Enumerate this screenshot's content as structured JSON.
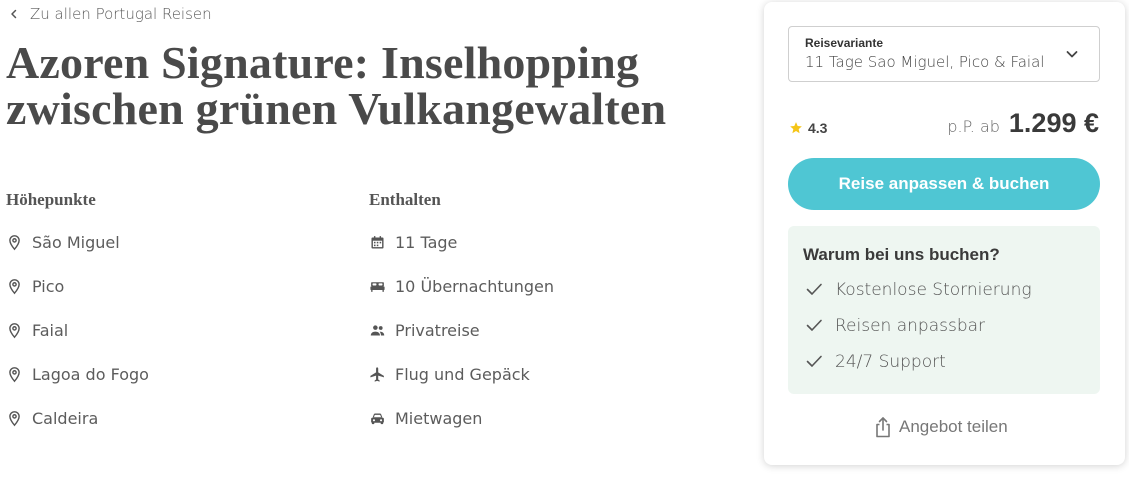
{
  "nav": {
    "back_label": "Zu allen Portugal Reisen"
  },
  "title": {
    "line1": "Azoren Signature: Inselhopping",
    "line2": "zwischen grünen Vulkangewalten"
  },
  "highlights": {
    "heading": "Höhepunkte",
    "items": [
      {
        "label": "São Miguel",
        "icon": "location-pin-icon"
      },
      {
        "label": "Pico",
        "icon": "location-pin-icon"
      },
      {
        "label": "Faial",
        "icon": "location-pin-icon"
      },
      {
        "label": "Lagoa do Fogo",
        "icon": "location-pin-icon"
      },
      {
        "label": "Caldeira",
        "icon": "location-pin-icon"
      }
    ]
  },
  "included": {
    "heading": "Enthalten",
    "items": [
      {
        "label": "11 Tage",
        "icon": "calendar-icon"
      },
      {
        "label": "10 Übernachtungen",
        "icon": "bed-icon"
      },
      {
        "label": "Privatreise",
        "icon": "people-icon"
      },
      {
        "label": "Flug und Gepäck",
        "icon": "airplane-icon"
      },
      {
        "label": "Mietwagen",
        "icon": "car-icon"
      }
    ]
  },
  "booking": {
    "variant_label": "Reisevariante",
    "variant_value": "11 Tage Sao Miguel, Pico & Faial",
    "rating": "4.3",
    "price_prefix": "p.P. ab",
    "price": "1.299 €",
    "cta_label": "Reise anpassen & buchen",
    "why_heading": "Warum bei uns buchen?",
    "why_items": [
      "Kostenlose Stornierung",
      "Reisen anpassbar",
      "24/7 Support"
    ],
    "share_label": "Angebot teilen"
  },
  "colors": {
    "accent": "#4fc6d3",
    "why_bg": "#eef6f1",
    "star": "#f5c518",
    "title": "#4a4a4a"
  }
}
